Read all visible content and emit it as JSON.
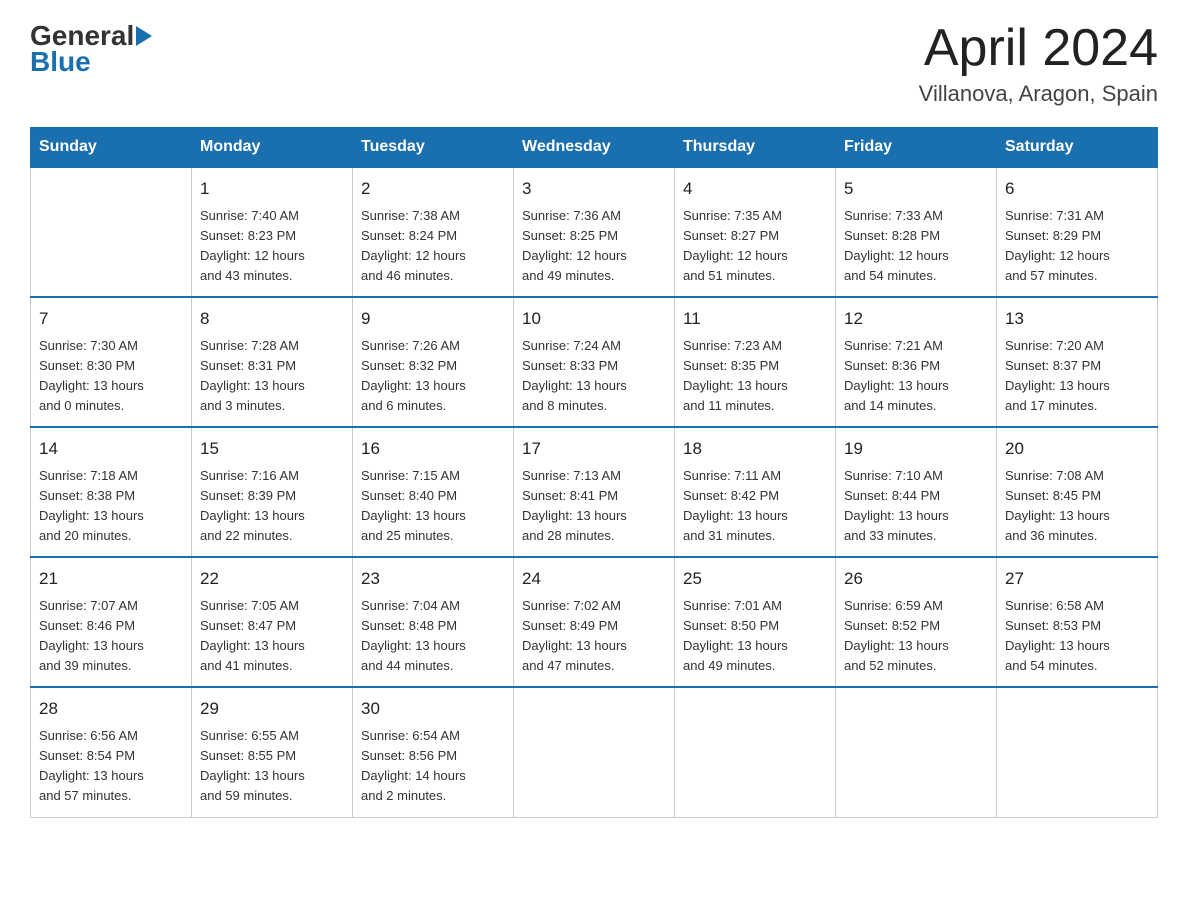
{
  "logo": {
    "general": "General",
    "blue": "Blue",
    "arrow": "▶"
  },
  "title": "April 2024",
  "subtitle": "Villanova, Aragon, Spain",
  "headers": [
    "Sunday",
    "Monday",
    "Tuesday",
    "Wednesday",
    "Thursday",
    "Friday",
    "Saturday"
  ],
  "weeks": [
    [
      {
        "day": "",
        "info": ""
      },
      {
        "day": "1",
        "info": "Sunrise: 7:40 AM\nSunset: 8:23 PM\nDaylight: 12 hours\nand 43 minutes."
      },
      {
        "day": "2",
        "info": "Sunrise: 7:38 AM\nSunset: 8:24 PM\nDaylight: 12 hours\nand 46 minutes."
      },
      {
        "day": "3",
        "info": "Sunrise: 7:36 AM\nSunset: 8:25 PM\nDaylight: 12 hours\nand 49 minutes."
      },
      {
        "day": "4",
        "info": "Sunrise: 7:35 AM\nSunset: 8:27 PM\nDaylight: 12 hours\nand 51 minutes."
      },
      {
        "day": "5",
        "info": "Sunrise: 7:33 AM\nSunset: 8:28 PM\nDaylight: 12 hours\nand 54 minutes."
      },
      {
        "day": "6",
        "info": "Sunrise: 7:31 AM\nSunset: 8:29 PM\nDaylight: 12 hours\nand 57 minutes."
      }
    ],
    [
      {
        "day": "7",
        "info": "Sunrise: 7:30 AM\nSunset: 8:30 PM\nDaylight: 13 hours\nand 0 minutes."
      },
      {
        "day": "8",
        "info": "Sunrise: 7:28 AM\nSunset: 8:31 PM\nDaylight: 13 hours\nand 3 minutes."
      },
      {
        "day": "9",
        "info": "Sunrise: 7:26 AM\nSunset: 8:32 PM\nDaylight: 13 hours\nand 6 minutes."
      },
      {
        "day": "10",
        "info": "Sunrise: 7:24 AM\nSunset: 8:33 PM\nDaylight: 13 hours\nand 8 minutes."
      },
      {
        "day": "11",
        "info": "Sunrise: 7:23 AM\nSunset: 8:35 PM\nDaylight: 13 hours\nand 11 minutes."
      },
      {
        "day": "12",
        "info": "Sunrise: 7:21 AM\nSunset: 8:36 PM\nDaylight: 13 hours\nand 14 minutes."
      },
      {
        "day": "13",
        "info": "Sunrise: 7:20 AM\nSunset: 8:37 PM\nDaylight: 13 hours\nand 17 minutes."
      }
    ],
    [
      {
        "day": "14",
        "info": "Sunrise: 7:18 AM\nSunset: 8:38 PM\nDaylight: 13 hours\nand 20 minutes."
      },
      {
        "day": "15",
        "info": "Sunrise: 7:16 AM\nSunset: 8:39 PM\nDaylight: 13 hours\nand 22 minutes."
      },
      {
        "day": "16",
        "info": "Sunrise: 7:15 AM\nSunset: 8:40 PM\nDaylight: 13 hours\nand 25 minutes."
      },
      {
        "day": "17",
        "info": "Sunrise: 7:13 AM\nSunset: 8:41 PM\nDaylight: 13 hours\nand 28 minutes."
      },
      {
        "day": "18",
        "info": "Sunrise: 7:11 AM\nSunset: 8:42 PM\nDaylight: 13 hours\nand 31 minutes."
      },
      {
        "day": "19",
        "info": "Sunrise: 7:10 AM\nSunset: 8:44 PM\nDaylight: 13 hours\nand 33 minutes."
      },
      {
        "day": "20",
        "info": "Sunrise: 7:08 AM\nSunset: 8:45 PM\nDaylight: 13 hours\nand 36 minutes."
      }
    ],
    [
      {
        "day": "21",
        "info": "Sunrise: 7:07 AM\nSunset: 8:46 PM\nDaylight: 13 hours\nand 39 minutes."
      },
      {
        "day": "22",
        "info": "Sunrise: 7:05 AM\nSunset: 8:47 PM\nDaylight: 13 hours\nand 41 minutes."
      },
      {
        "day": "23",
        "info": "Sunrise: 7:04 AM\nSunset: 8:48 PM\nDaylight: 13 hours\nand 44 minutes."
      },
      {
        "day": "24",
        "info": "Sunrise: 7:02 AM\nSunset: 8:49 PM\nDaylight: 13 hours\nand 47 minutes."
      },
      {
        "day": "25",
        "info": "Sunrise: 7:01 AM\nSunset: 8:50 PM\nDaylight: 13 hours\nand 49 minutes."
      },
      {
        "day": "26",
        "info": "Sunrise: 6:59 AM\nSunset: 8:52 PM\nDaylight: 13 hours\nand 52 minutes."
      },
      {
        "day": "27",
        "info": "Sunrise: 6:58 AM\nSunset: 8:53 PM\nDaylight: 13 hours\nand 54 minutes."
      }
    ],
    [
      {
        "day": "28",
        "info": "Sunrise: 6:56 AM\nSunset: 8:54 PM\nDaylight: 13 hours\nand 57 minutes."
      },
      {
        "day": "29",
        "info": "Sunrise: 6:55 AM\nSunset: 8:55 PM\nDaylight: 13 hours\nand 59 minutes."
      },
      {
        "day": "30",
        "info": "Sunrise: 6:54 AM\nSunset: 8:56 PM\nDaylight: 14 hours\nand 2 minutes."
      },
      {
        "day": "",
        "info": ""
      },
      {
        "day": "",
        "info": ""
      },
      {
        "day": "",
        "info": ""
      },
      {
        "day": "",
        "info": ""
      }
    ]
  ]
}
